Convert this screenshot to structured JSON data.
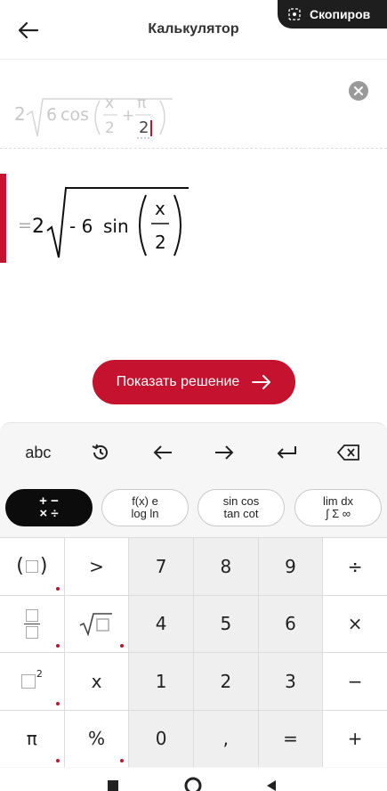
{
  "header": {
    "title": "Калькулятор"
  },
  "toast": {
    "text": "Скопиров"
  },
  "input": {
    "coef": "2",
    "inner_coef": "6",
    "func": "cos",
    "num1": "x",
    "den1": "2",
    "plus": "+",
    "num2": "π",
    "den2": "2"
  },
  "result": {
    "eq": "=",
    "coef": "2",
    "inner": "- 6",
    "func": "sin",
    "num": "x",
    "den": "2"
  },
  "show_solution": {
    "label": "Показать решение"
  },
  "toolbar": {
    "abc": "abc"
  },
  "tabs": [
    {
      "line1": "+ −",
      "line2": "× ÷"
    },
    {
      "line1": "f(x)  e",
      "line2": "log  ln"
    },
    {
      "line1": "sin cos",
      "line2": "tan cot"
    },
    {
      "line1": "lim  dx",
      "line2": "∫ Σ ∞"
    }
  ],
  "keys": {
    "r1": [
      "",
      ">",
      "7",
      "8",
      "9",
      "÷"
    ],
    "r2": [
      "",
      "",
      "4",
      "5",
      "6",
      "×"
    ],
    "r3": [
      "",
      "x",
      "1",
      "2",
      "3",
      "−"
    ],
    "r4": [
      "π",
      "%",
      "0",
      ",",
      "=",
      "+"
    ],
    "sup2": "2"
  },
  "colors": {
    "accent": "#c4122f",
    "keyboard_bg": "#f6f6f6"
  }
}
